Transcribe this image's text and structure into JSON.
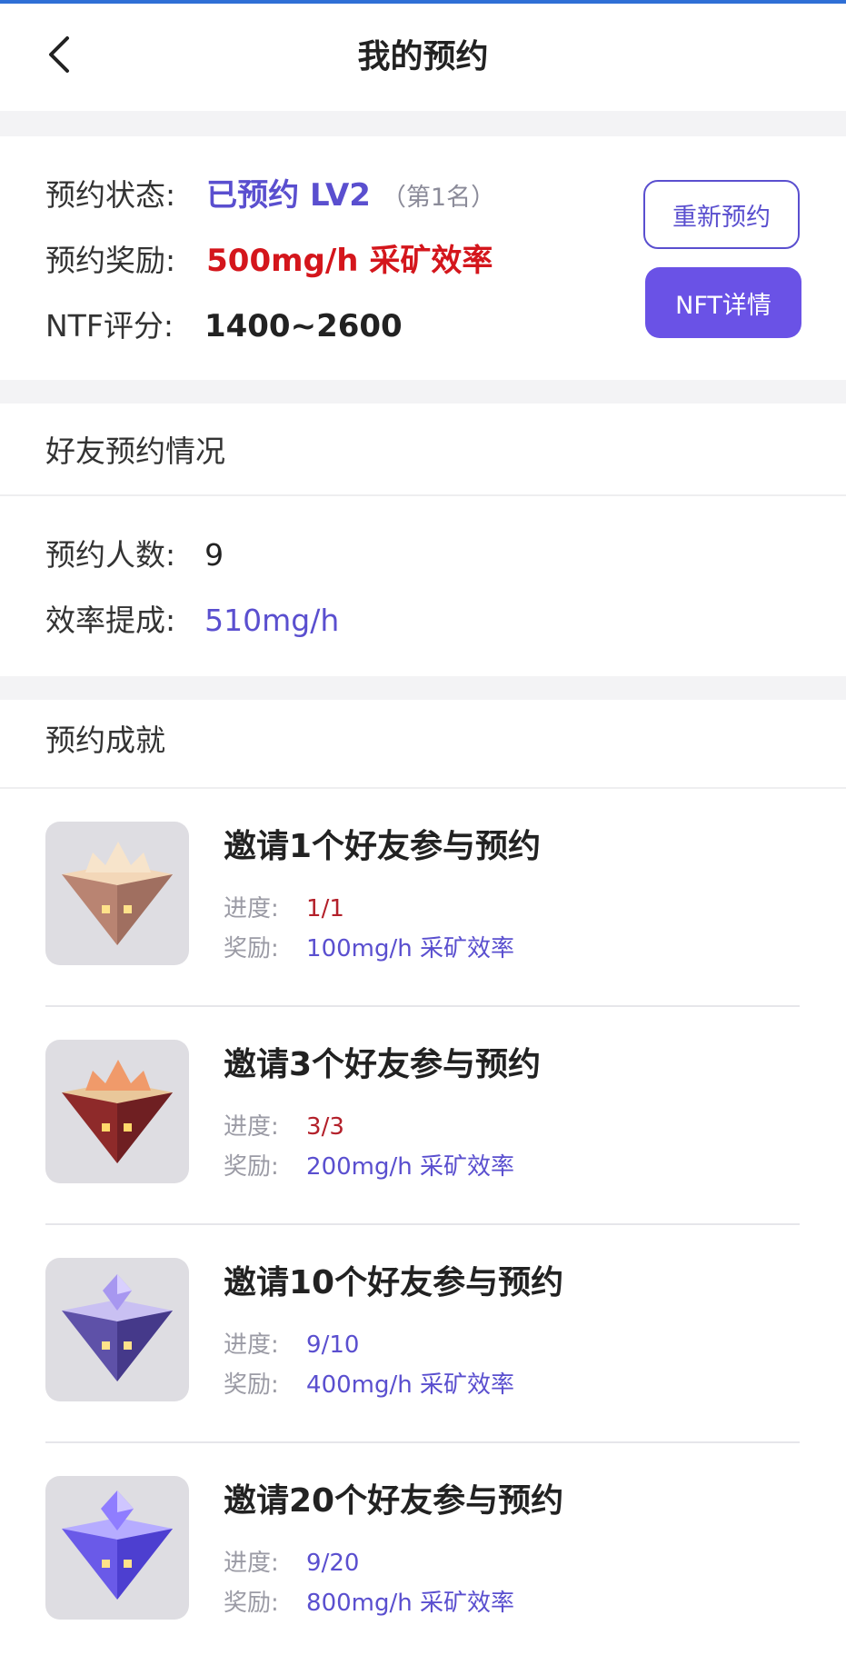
{
  "nav": {
    "title": "我的预约",
    "back_icon": "chevron-left-icon"
  },
  "reservation": {
    "status_label": "预约状态:",
    "status_value": "已预约 LV2",
    "status_rank": "（第1名）",
    "reward_label": "预约奖励:",
    "reward_value": "500mg/h 采矿效率",
    "score_label": "NTF评分:",
    "score_value": "1400~2600",
    "rebook_button": "重新预约",
    "nft_button": "NFT详情"
  },
  "friends": {
    "title": "好友预约情况",
    "count_label": "预约人数:",
    "count_value": "9",
    "commission_label": "效率提成:",
    "commission_value": "510mg/h"
  },
  "achievements": {
    "title": "预约成就",
    "progress_label": "进度:",
    "reward_label": "奖励:",
    "items": [
      {
        "title": "邀请1个好友参与预约",
        "progress": "1/1",
        "reward": "100mg/h 采矿效率",
        "icon": "crown-pyramid-tan-icon"
      },
      {
        "title": "邀请3个好友参与预约",
        "progress": "3/3",
        "reward": "200mg/h 采矿效率",
        "icon": "crown-pyramid-red-icon"
      },
      {
        "title": "邀请10个好友参与预约",
        "progress": "9/10",
        "reward": "400mg/h 采矿效率",
        "icon": "crystal-pyramid-purple-icon"
      },
      {
        "title": "邀请20个好友参与预约",
        "progress": "9/20",
        "reward": "800mg/h 采矿效率",
        "icon": "crystal-pyramid-violet-icon"
      }
    ]
  },
  "colors": {
    "accent": "#5a4fcf",
    "button_fill": "#6a52e6",
    "reward_red": "#d4161c",
    "progress_done": "#b3202a"
  }
}
